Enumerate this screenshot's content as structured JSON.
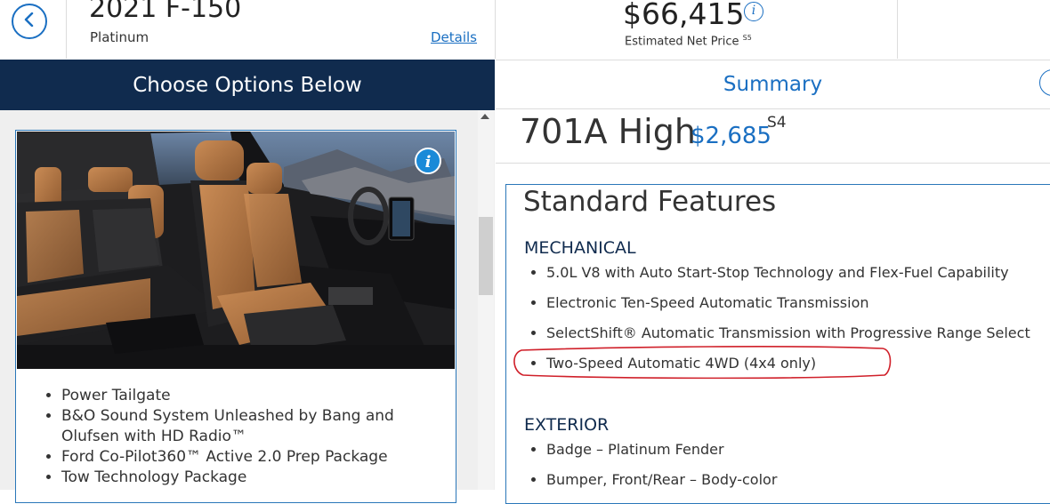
{
  "header": {
    "model": "2021 F-150",
    "trim": "Platinum",
    "details_link": "Details",
    "price": "$66,415",
    "price_info_icon": "i",
    "net_price_label": "Estimated Net Price",
    "net_price_footnote": "S5"
  },
  "left": {
    "band_title": "Choose Options Below",
    "image_info_icon": "i",
    "features": [
      "Power Tailgate",
      "B&O Sound System Unleashed by Bang and Olufsen with HD Radio™",
      "Ford Co-Pilot360™ Active 2.0 Prep Package",
      "Tow Technology Package"
    ]
  },
  "right": {
    "summary_tab": "Summary",
    "package_name": "701A High",
    "package_price": "$2,685",
    "package_footnote": "S4",
    "standard_features_title": "Standard Features",
    "sections": [
      {
        "heading": "MECHANICAL",
        "items": [
          "5.0L V8 with Auto Start-Stop Technology and Flex-Fuel Capability",
          "Electronic Ten-Speed Automatic Transmission",
          "SelectShift® Automatic Transmission with Progressive Range Select",
          "Two-Speed Automatic 4WD (4x4 only)"
        ]
      },
      {
        "heading": "EXTERIOR",
        "items": [
          "Badge – Platinum Fender",
          "Bumper, Front/Rear – Body-color"
        ]
      }
    ]
  },
  "colors": {
    "navy": "#102b4e",
    "accent_blue": "#1a6fc2",
    "highlight_red": "#d0202a"
  }
}
